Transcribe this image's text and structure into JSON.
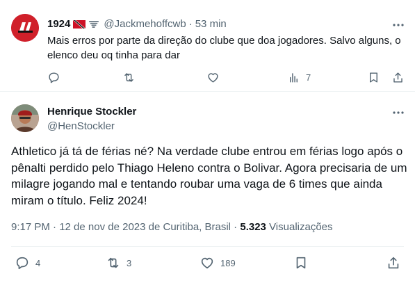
{
  "reply": {
    "name": "1924",
    "handle": "@Jackmehoffcwb",
    "separator": "·",
    "time": "53 min",
    "text": "Mais erros por parte da direção do clube que doa jogadores. Salvo alguns, o elenco deu oq tinha para dar",
    "views": "7"
  },
  "main": {
    "name": "Henrique Stockler",
    "handle": "@HenStockler",
    "text": "Athletico já tá de férias né? Na verdade clube entrou em férias logo após o pênalti perdido pelo Thiago Heleno contra o Bolivar. Agora precisaria de um milagre jogando mal e tentando roubar uma vaga de 6 times que ainda miram o título. Feliz 2024!",
    "timestamp": "9:17 PM · 12 de nov de 2023 de Curitiba, Brasil ·",
    "views_count": "5.323",
    "views_label": "Visualizações",
    "replies": "4",
    "reposts": "3",
    "likes": "189"
  },
  "colors": {
    "text": "#0f1419",
    "muted": "#536471",
    "border": "#eff3f4",
    "accent": "#c8102e"
  },
  "icons": [
    "reply-icon",
    "repost-icon",
    "like-icon",
    "views-icon",
    "bookmark-icon",
    "share-icon",
    "more-icon"
  ]
}
